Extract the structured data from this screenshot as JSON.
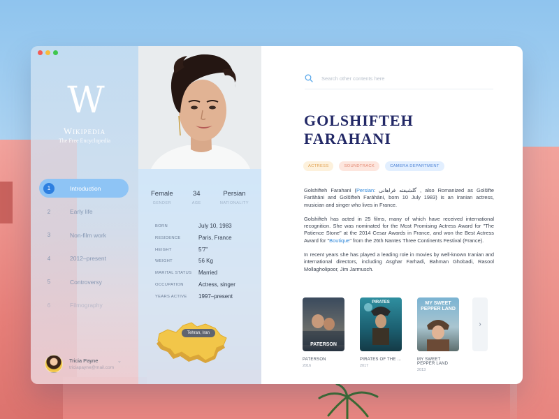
{
  "window": {
    "controls": [
      "close",
      "minimize",
      "maximize"
    ]
  },
  "sidebar": {
    "logo_letter": "W",
    "logo_name": "Wikipedia",
    "logo_tagline": "The Free Encyclopedia",
    "nav": [
      {
        "num": "1",
        "label": "Introduction",
        "active": true
      },
      {
        "num": "2",
        "label": "Early life"
      },
      {
        "num": "3",
        "label": "Non-film work"
      },
      {
        "num": "4",
        "label": "2012–present"
      },
      {
        "num": "5",
        "label": "Controversy"
      },
      {
        "num": "6",
        "label": "Filmography"
      }
    ],
    "user": {
      "name": "Tricia Payne",
      "email": "triciapayne@mail.com"
    }
  },
  "profile": {
    "stats": [
      {
        "value": "Female",
        "label": "GENDER"
      },
      {
        "value": "34",
        "label": "AGE"
      },
      {
        "value": "Persian",
        "label": "NATIONALITY"
      }
    ],
    "info": [
      {
        "key": "BORN",
        "value": "July 10, 1983"
      },
      {
        "key": "RESIDENCE",
        "value": "Paris, France"
      },
      {
        "key": "HEIGHT",
        "value": "5'7\""
      },
      {
        "key": "WEIGHT",
        "value": "56 Kg"
      },
      {
        "key": "MARITAL STATUS",
        "value": "Married"
      },
      {
        "key": "OCCUPATION",
        "value": "Actress, singer"
      },
      {
        "key": "YEARS ACTIVE",
        "value": "1997–present"
      }
    ],
    "map_label": "Tehran, Iran"
  },
  "main": {
    "search_placeholder": "Search other contents here",
    "title_line1": "GOLSHIFTEH",
    "title_line2": "FARAHANI",
    "tags": [
      "ACTRESS",
      "SOUNDTRACK",
      "CAMERA DEPARTMENT"
    ],
    "para1": {
      "pre": "Golshifteh Farahani (",
      "link": "Persian",
      "post": ": گلشیفته فراهانی , also Romanized as Golšifte Farāhāni and Golšifteh Farāhāni, born 10 July 1983) is an Iranian actress, musician and singer who lives in France."
    },
    "para2": {
      "pre": "Golshifteh has acted in 25 films, many of which have received international recognition. She was nominated for the Most Promising Actress Award for \"The Patience Stone\" at the 2014 Cesar Awards in France, and won the Best Actress Award for \"",
      "link": "Boutique",
      "post": "\" from the 26th Nantes Three Continents Festival (France)."
    },
    "para3": "In recent years she has played a leading role in movies by well-known Iranian and international directors, including Asghar Farhadi, Bahman Ghobadi, Rasool Mollagholipoor, Jim Jarmusch.",
    "films": [
      {
        "name": "PATERSON",
        "year": "2016",
        "poster_text": "PATERSON"
      },
      {
        "name": "PIRATES OF THE ...",
        "year": "2017",
        "poster_text": "PIRATES"
      },
      {
        "name": "MY SWEET PEPPER LAND",
        "year": "2013",
        "poster_text": "MY SWEET PEPPER LAND"
      }
    ],
    "next_icon": "chevron-right-icon",
    "next_glyph": "›"
  },
  "colors": {
    "accent": "#2d7fe0",
    "title": "#222866",
    "tag_actress": "#e0a050",
    "tag_soundtrack": "#e38872",
    "tag_camera": "#4f84d6"
  }
}
